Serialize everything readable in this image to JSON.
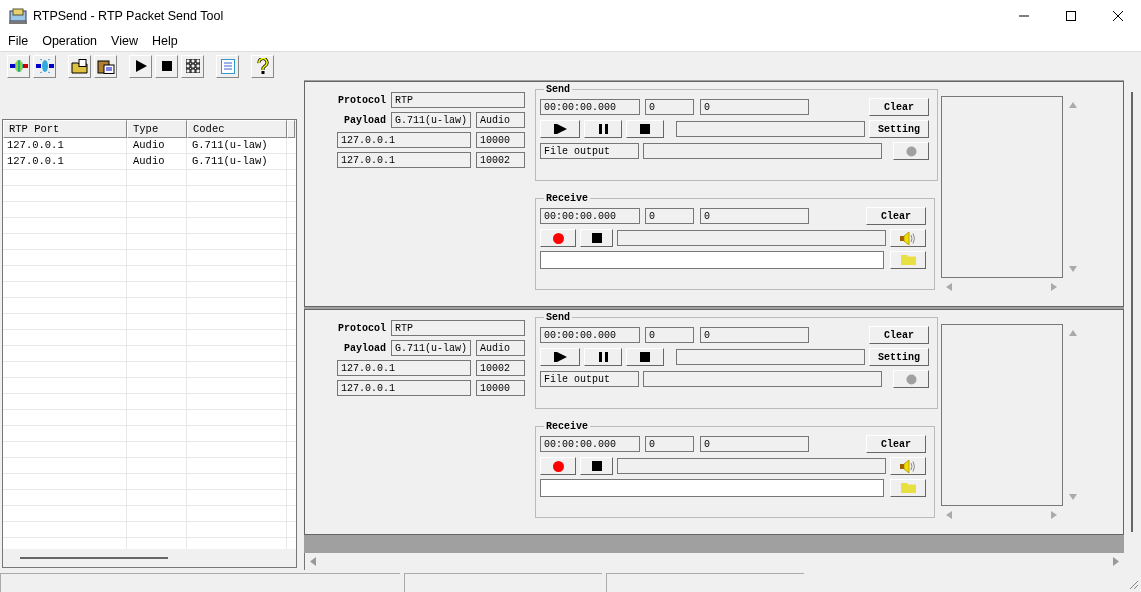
{
  "window": {
    "title": "RTPSend - RTP Packet Send Tool"
  },
  "menu": [
    "File",
    "Operation",
    "View",
    "Help"
  ],
  "toolbar": [
    [
      {
        "kind": "connect"
      },
      {
        "kind": "disconnect"
      }
    ],
    [
      {
        "kind": "open"
      },
      {
        "kind": "paste"
      }
    ],
    [
      {
        "kind": "play"
      },
      {
        "kind": "stop"
      },
      {
        "kind": "grid"
      }
    ],
    [
      {
        "kind": "list"
      }
    ],
    [
      {
        "kind": "help"
      }
    ]
  ],
  "list": {
    "columns": [
      "RTP Port",
      "Type",
      "Codec"
    ],
    "rows": [
      [
        "127.0.0.1",
        "Audio",
        "G.711(u-law)"
      ],
      [
        "127.0.0.1",
        "Audio",
        "G.711(u-law)"
      ]
    ]
  },
  "channels": [
    {
      "protocol_label": "Protocol",
      "protocol": "RTP",
      "payload_label": "Payload",
      "payload": "G.711(u-law)",
      "media": "Audio",
      "endpoints": [
        {
          "address": "127.0.0.1",
          "port": "10000"
        },
        {
          "address": "127.0.0.1",
          "port": "10002"
        }
      ],
      "send": {
        "title": "Send",
        "time": "00:00:00.000",
        "packets": "0",
        "bytes": "0",
        "clear": "Clear",
        "setting": "Setting",
        "file_output": "File output"
      },
      "receive": {
        "title": "Receive",
        "time": "00:00:00.000",
        "packets": "0",
        "bytes": "0",
        "clear": "Clear"
      }
    },
    {
      "protocol_label": "Protocol",
      "protocol": "RTP",
      "payload_label": "Payload",
      "payload": "G.711(u-law)",
      "media": "Audio",
      "endpoints": [
        {
          "address": "127.0.0.1",
          "port": "10002"
        },
        {
          "address": "127.0.0.1",
          "port": "10000"
        }
      ],
      "send": {
        "title": "Send",
        "time": "00:00:00.000",
        "packets": "0",
        "bytes": "0",
        "clear": "Clear",
        "setting": "Setting",
        "file_output": "File output"
      },
      "receive": {
        "title": "Receive",
        "time": "00:00:00.000",
        "packets": "0",
        "bytes": "0",
        "clear": "Clear"
      }
    }
  ]
}
